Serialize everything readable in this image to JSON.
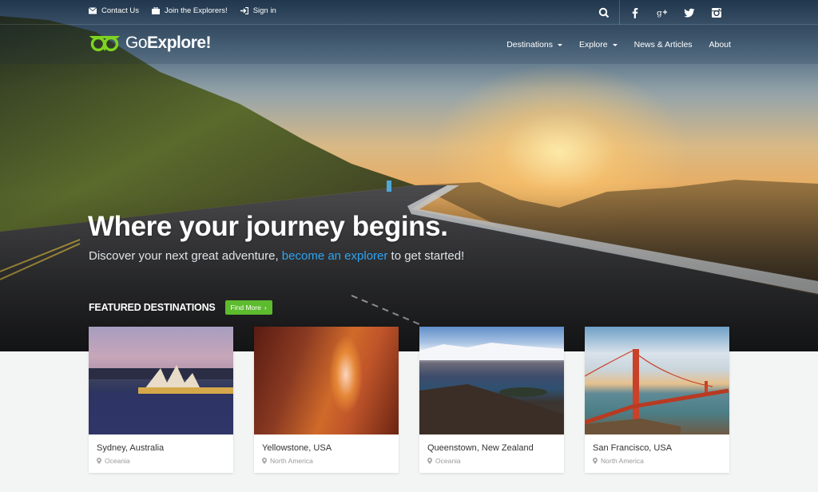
{
  "topbar": {
    "links": [
      {
        "label": "Contact Us",
        "icon": "envelope-icon"
      },
      {
        "label": "Join the Explorers!",
        "icon": "briefcase-icon"
      },
      {
        "label": "Sign in",
        "icon": "sign-in-icon"
      }
    ],
    "icons": [
      "search-icon",
      "facebook-icon",
      "google-plus-icon",
      "twitter-icon",
      "instagram-icon"
    ]
  },
  "brand": {
    "name_light": "Go",
    "name_bold": "Explore!",
    "accent": "#7ed321"
  },
  "nav": {
    "items": [
      {
        "label": "Destinations",
        "dropdown": true
      },
      {
        "label": "Explore",
        "dropdown": true
      },
      {
        "label": "News & Articles",
        "dropdown": false
      },
      {
        "label": "About",
        "dropdown": false
      }
    ]
  },
  "hero": {
    "headline": "Where your journey begins.",
    "sub_before": "Discover your next great adventure, ",
    "sub_link": "become an explorer",
    "sub_after": " to get started!",
    "link_color": "#2ea3f2"
  },
  "featured": {
    "title": "FEATURED DESTINATIONS",
    "button_label": "Find More",
    "button_color": "#5dbb2e",
    "cards": [
      {
        "title": "Sydney, Australia",
        "region": "Oceania"
      },
      {
        "title": "Yellowstone, USA",
        "region": "North America"
      },
      {
        "title": "Queenstown, New Zealand",
        "region": "Oceania"
      },
      {
        "title": "San Francisco, USA",
        "region": "North America"
      }
    ]
  }
}
